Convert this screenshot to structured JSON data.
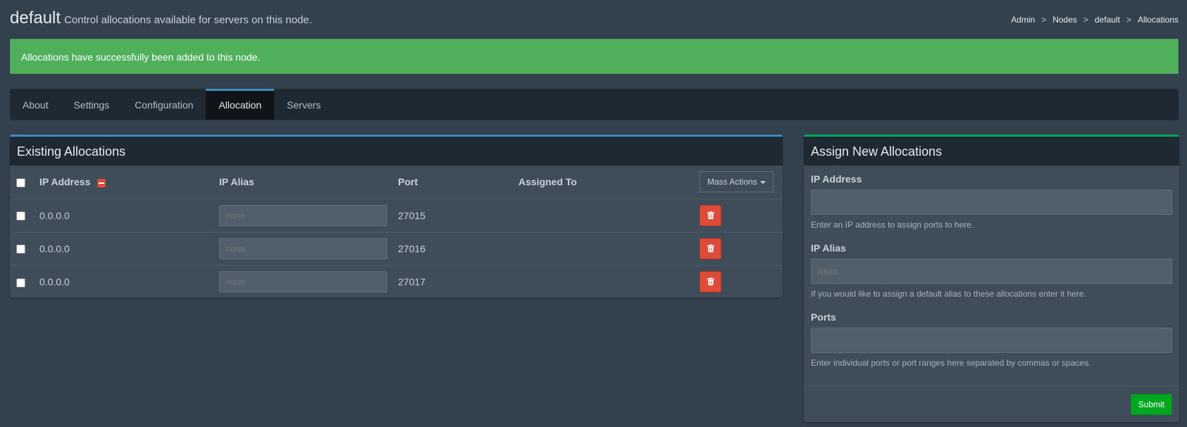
{
  "page": {
    "title": "default",
    "subtitle": "Control allocations available for servers on this node."
  },
  "breadcrumb": [
    "Admin",
    "Nodes",
    "default",
    "Allocations"
  ],
  "alert": {
    "message": "Allocations have successfully been added to this node."
  },
  "tabs": [
    {
      "label": "About",
      "active": false
    },
    {
      "label": "Settings",
      "active": false
    },
    {
      "label": "Configuration",
      "active": false
    },
    {
      "label": "Allocation",
      "active": true
    },
    {
      "label": "Servers",
      "active": false
    }
  ],
  "existing": {
    "title": "Existing Allocations",
    "columns": {
      "ip_address": "IP Address",
      "ip_alias": "IP Alias",
      "port": "Port",
      "assigned_to": "Assigned To"
    },
    "mass_actions_label": "Mass Actions",
    "rows": [
      {
        "ip": "0.0.0.0",
        "alias_placeholder": "none",
        "port": "27015",
        "assigned_to": ""
      },
      {
        "ip": "0.0.0.0",
        "alias_placeholder": "none",
        "port": "27016",
        "assigned_to": ""
      },
      {
        "ip": "0.0.0.0",
        "alias_placeholder": "none",
        "port": "27017",
        "assigned_to": ""
      }
    ]
  },
  "assign": {
    "title": "Assign New Allocations",
    "ip_address": {
      "label": "IP Address",
      "value": "",
      "help": "Enter an IP address to assign ports to here."
    },
    "ip_alias": {
      "label": "IP Alias",
      "placeholder": "alias",
      "help": "If you would like to assign a default alias to these allocations enter it here."
    },
    "ports": {
      "label": "Ports",
      "value": "",
      "help": "Enter individual ports or port ranges here separated by commas or spaces."
    },
    "submit_label": "Submit"
  },
  "colors": {
    "background": "#33404d",
    "alert_success": "#50af5b",
    "primary_accent": "#3c8dbc",
    "success_accent": "#00a65a",
    "danger": "#dd4b39",
    "submit": "#00a61e"
  },
  "icons": {
    "sort": "minus-square-icon",
    "delete": "trash-icon",
    "dropdown": "caret-down-icon"
  }
}
